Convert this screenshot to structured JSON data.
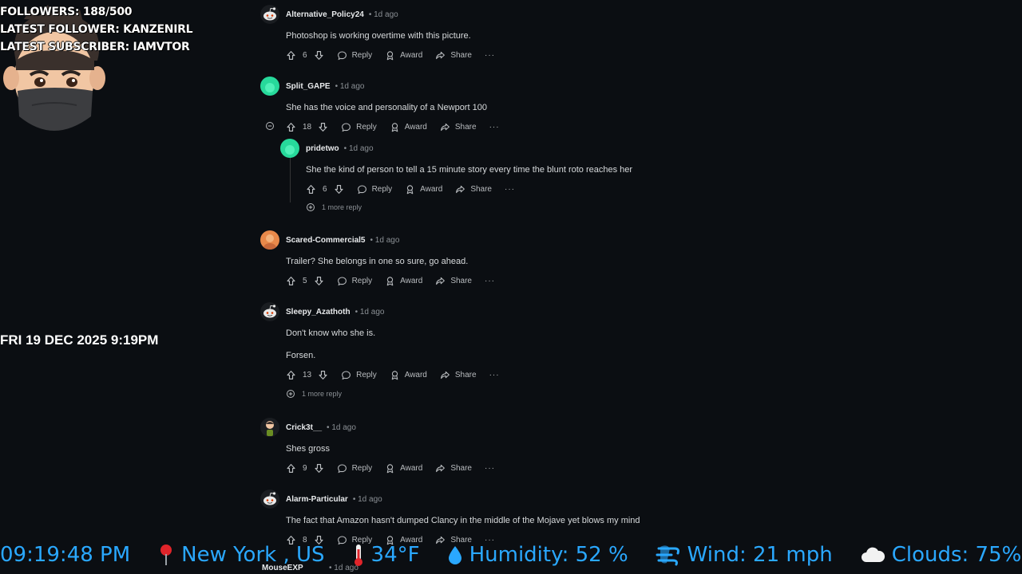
{
  "overlay": {
    "followers": "FOLLOWERS: 188/500",
    "latest_follower": "LATEST FOLLOWER: KANZENIRL",
    "latest_subscriber": "LATEST SUBSCRIBER: IAMVTOR",
    "datetime": "FRI 19 DEC 2025 9:19PM"
  },
  "labels": {
    "reply": "Reply",
    "award": "Award",
    "share": "Share",
    "more": "···",
    "dot": "•"
  },
  "comments": [
    {
      "user": "Alternative_Policy24",
      "time": "1d ago",
      "text": [
        "Photoshop is working overtime with this picture."
      ],
      "votes": "6"
    },
    {
      "user": "Split_GAPE",
      "time": "1d ago",
      "text": [
        "She has the voice and personality of a Newport 100"
      ],
      "votes": "18"
    },
    {
      "user": "pridetwo",
      "time": "1d ago",
      "text": [
        "She the kind of person to tell a 15 minute story every time the blunt roto reaches her"
      ],
      "votes": "6",
      "more_replies": "1 more reply"
    },
    {
      "user": "Scared-Commercial5",
      "time": "1d ago",
      "text": [
        "Trailer? She belongs in one so sure, go ahead."
      ],
      "votes": "5"
    },
    {
      "user": "Sleepy_Azathoth",
      "time": "1d ago",
      "text": [
        "Don't know who she is.",
        "Forsen."
      ],
      "votes": "13",
      "more_replies": "1 more reply"
    },
    {
      "user": "Crick3t__",
      "time": "1d ago",
      "text": [
        "Shes gross"
      ],
      "votes": "9"
    },
    {
      "user": "Alarm-Particular",
      "time": "1d ago",
      "text": [
        "The fact that Amazon hasn't dumped Clancy in the middle of the Mojave yet blows my mind"
      ],
      "votes": "8"
    },
    {
      "user": "MouseEXP",
      "time": "1d ago"
    }
  ],
  "ticker": {
    "time": "09:19:48 PM",
    "location": "New York , US",
    "temperature": "34°F",
    "humidity": "Humidity: 52 %",
    "wind": "Wind: 21 mph",
    "clouds": "Clouds: 75%"
  },
  "colors": {
    "background": "#0b0e12",
    "ticker_text": "#2aa8ff",
    "avatar_green": "#27d99b",
    "avatar_orange": "#e8894a"
  }
}
